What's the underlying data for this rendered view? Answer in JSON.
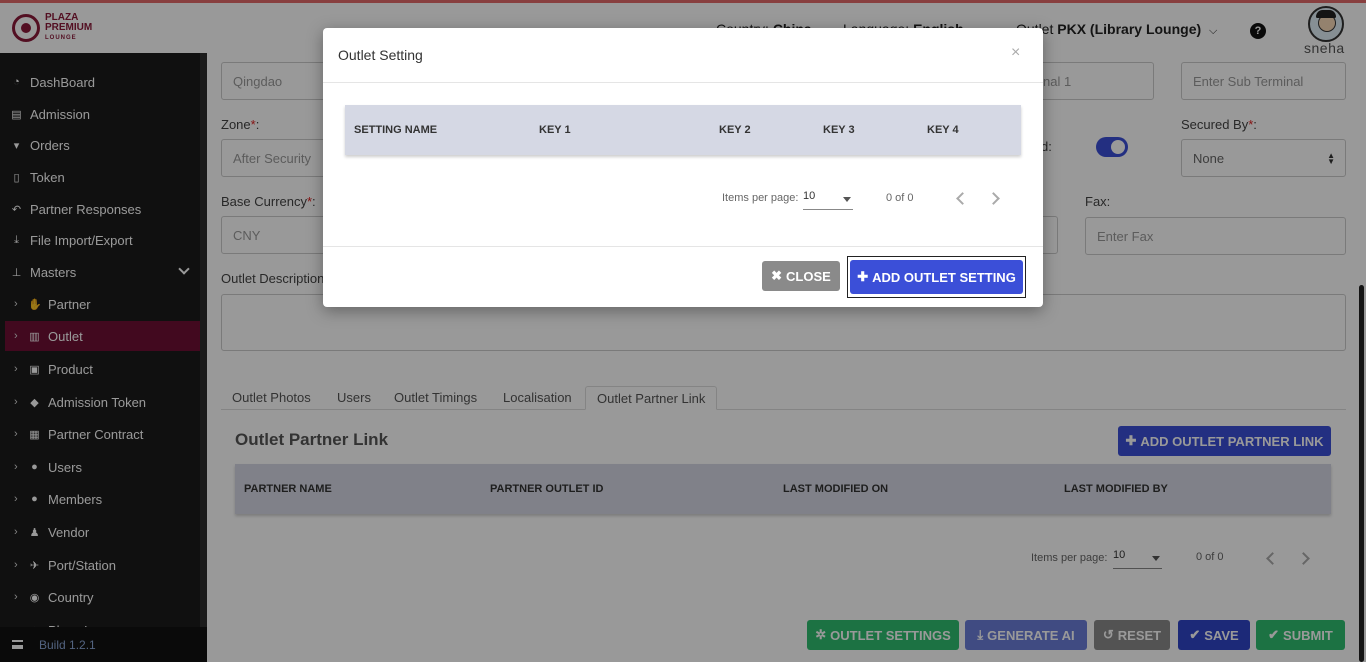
{
  "header": {
    "logo_line1": "PLAZA",
    "logo_line2": "PREMIUM",
    "logo_line3": "LOUNGE",
    "country_label": "Country:",
    "country_value": "China",
    "language_label": "Language:",
    "language_value": "English",
    "outlet_label": "Outlet",
    "outlet_value": "PKX (Library Lounge)",
    "help_glyph": "?",
    "username": "sneha"
  },
  "sidebar": {
    "items": [
      {
        "label": "DashBoard",
        "icon": "dashboard-icon",
        "glyph": "◔"
      },
      {
        "label": "Admission",
        "icon": "id-card-icon",
        "glyph": "▤"
      },
      {
        "label": "Orders",
        "icon": "cart-icon",
        "glyph": "🛒"
      },
      {
        "label": "Token",
        "icon": "file-icon",
        "glyph": "▯"
      },
      {
        "label": "Partner Responses",
        "icon": "reply-icon",
        "glyph": "↶"
      },
      {
        "label": "File Import/Export",
        "icon": "download-icon",
        "glyph": "⤓"
      },
      {
        "label": "Masters",
        "icon": "sitemap-icon",
        "glyph": "⊥"
      }
    ],
    "sub_items": [
      {
        "label": "Partner",
        "icon": "handshake-icon",
        "glyph": "✋"
      },
      {
        "label": "Outlet",
        "icon": "building-icon",
        "glyph": "▥"
      },
      {
        "label": "Product",
        "icon": "gift-icon",
        "glyph": "▣"
      },
      {
        "label": "Admission Token",
        "icon": "tag-icon",
        "glyph": "◆"
      },
      {
        "label": "Partner Contract",
        "icon": "briefcase-icon",
        "glyph": "▦"
      },
      {
        "label": "Users",
        "icon": "user-icon",
        "glyph": "●"
      },
      {
        "label": "Members",
        "icon": "users-icon",
        "glyph": "●"
      },
      {
        "label": "Vendor",
        "icon": "person-icon",
        "glyph": "♟"
      },
      {
        "label": "Port/Station",
        "icon": "plane-icon",
        "glyph": "✈"
      },
      {
        "label": "Country",
        "icon": "globe-icon",
        "glyph": "◉"
      },
      {
        "label": "Plaza Lounge",
        "icon": "tag-icon",
        "glyph": "◆"
      }
    ],
    "build": "Build 1.2.1"
  },
  "form": {
    "city_value": "Qingdao",
    "terminal_value": "nal 1",
    "sub_terminal_placeholder": "Enter Sub Terminal",
    "zone_label": "Zone",
    "zone_value": "After Security",
    "secured_label_partial": "d:",
    "secured_by_label": "Secured By",
    "secured_by_value": "None",
    "base_currency_label": "Base Currency",
    "base_currency_value": "CNY",
    "fax_label": "Fax:",
    "fax_placeholder": "Enter Fax",
    "description_label": "Outlet Description",
    "required_mark": "*",
    "colon": ":"
  },
  "tabs": [
    "Outlet Photos",
    "Users",
    "Outlet Timings",
    "Localisation",
    "Outlet Partner Link"
  ],
  "partner_link": {
    "title": "Outlet Partner Link",
    "add_button": "ADD OUTLET PARTNER LINK",
    "columns": [
      "PARTNER NAME",
      "PARTNER OUTLET ID",
      "LAST MODIFIED ON",
      "LAST MODIFIED BY"
    ],
    "items_per_page_label": "Items per page:",
    "items_per_page": "10",
    "range": "0 of 0"
  },
  "actions": {
    "outlet_settings": "OUTLET SETTINGS",
    "generate_ai": "GENERATE AI",
    "reset": "RESET",
    "save": "SAVE",
    "submit": "SUBMIT"
  },
  "modal": {
    "title": "Outlet Setting",
    "close_glyph": "×",
    "columns": [
      "SETTING NAME",
      "KEY 1",
      "KEY 2",
      "KEY 3",
      "KEY 4"
    ],
    "items_per_page_label": "Items per page:",
    "items_per_page": "10",
    "range": "0 of 0",
    "close_button": "CLOSE",
    "add_button": "ADD OUTLET SETTING"
  },
  "colors": {
    "sidebar_bg": "#1b1b1b",
    "active_item": "#6e0f35",
    "primary": "#3b4fd8",
    "success": "#2fbf71"
  }
}
